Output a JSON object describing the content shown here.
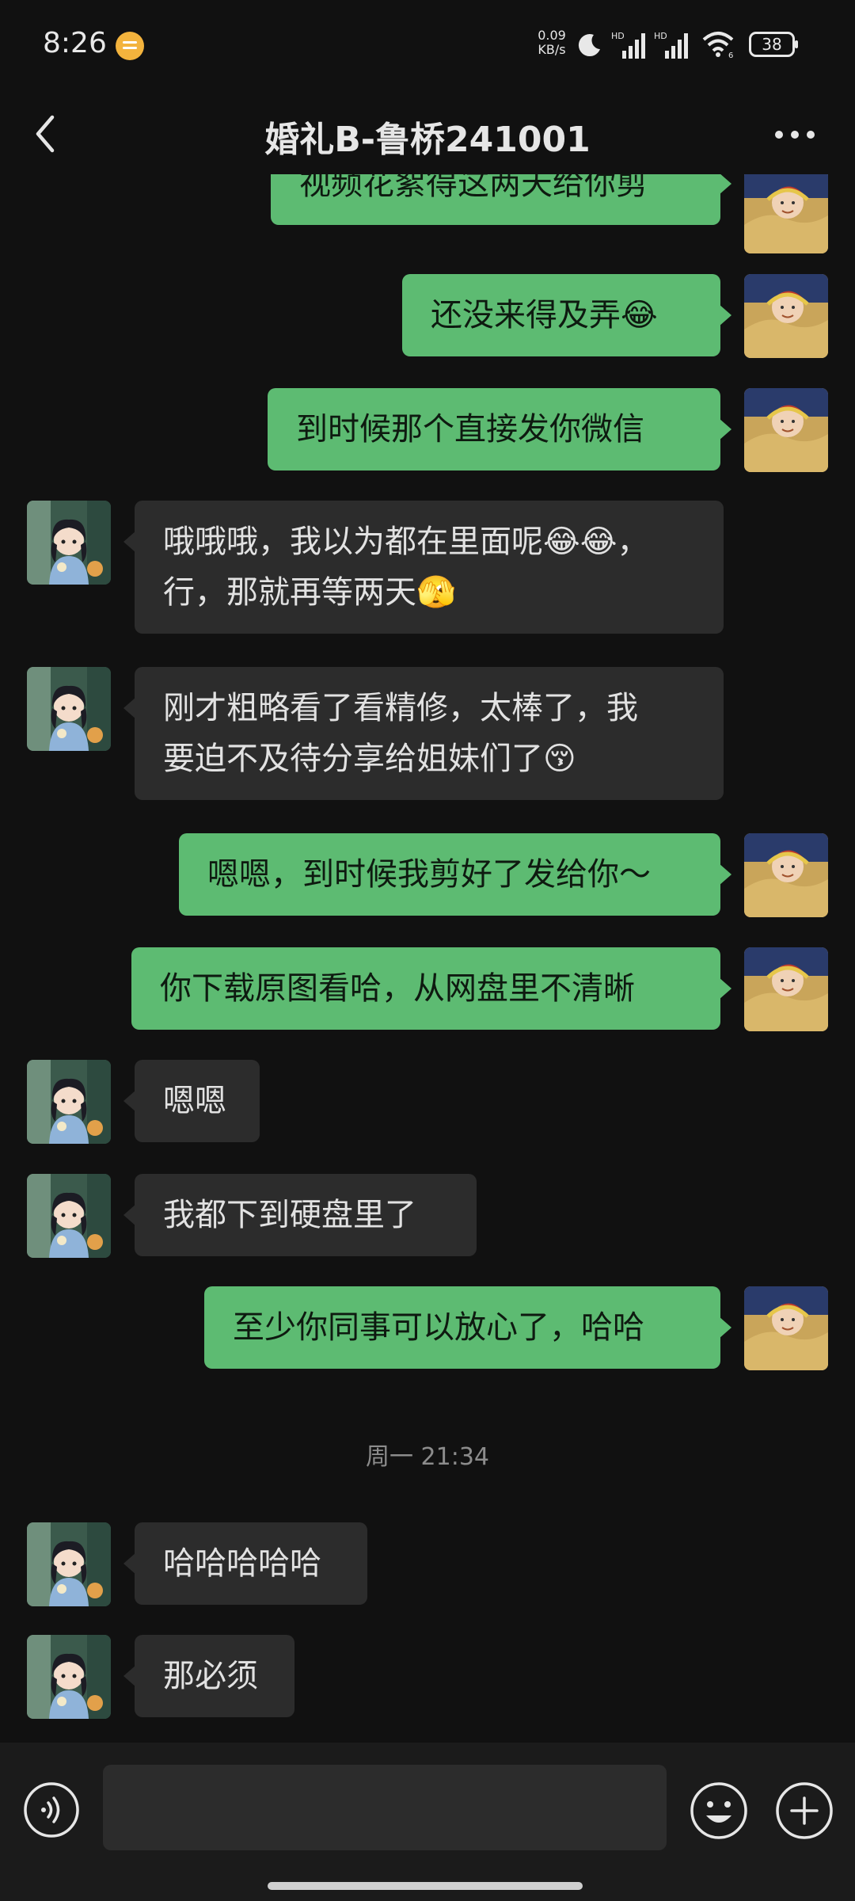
{
  "status_bar": {
    "time": "8:26",
    "net_speed_value": "0.09",
    "net_speed_unit": "KB/s",
    "signal_1_label": "HD",
    "signal_2_label": "HD",
    "wifi_label": "6",
    "battery": "38"
  },
  "header": {
    "title": "婚礼B-鲁桥241001"
  },
  "messages": [
    {
      "sender": "me",
      "text": "视频花絮得这两天给你剪"
    },
    {
      "sender": "me",
      "text": "还没来得及弄😂"
    },
    {
      "sender": "me",
      "text": "到时候那个直接发你微信"
    },
    {
      "sender": "them",
      "text": "哦哦哦，我以为都在里面呢😂😂，",
      "text_line2": "行，那就再等两天🫣"
    },
    {
      "sender": "them",
      "text": "刚才粗略看了看精修，太棒了，我",
      "text_line2": "要迫不及待分享给姐妹们了😚"
    },
    {
      "sender": "me",
      "text": "嗯嗯，到时候我剪好了发给你～"
    },
    {
      "sender": "me",
      "text": "你下载原图看哈，从网盘里不清晰"
    },
    {
      "sender": "them",
      "text": "嗯嗯"
    },
    {
      "sender": "them",
      "text": "我都下到硬盘里了"
    },
    {
      "sender": "me",
      "text": "至少你同事可以放心了，哈哈"
    },
    {
      "sender": "them",
      "text": "哈哈哈哈哈"
    },
    {
      "sender": "them",
      "text": "那必须"
    }
  ],
  "time_divider": "周一 21:34",
  "input": {
    "value": "",
    "placeholder": ""
  },
  "icons": {
    "back": "chevron-left-icon",
    "more": "more-dots-icon",
    "voice": "voice-icon",
    "emoji": "emoji-icon",
    "plus": "plus-icon"
  },
  "colors": {
    "my_bubble": "#5dbb72",
    "their_bubble": "#2c2c2c",
    "background": "#111111"
  }
}
